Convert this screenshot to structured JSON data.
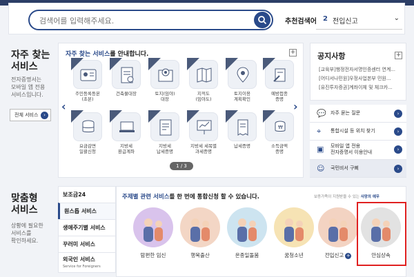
{
  "search": {
    "placeholder": "검색어를 입력해주세요.",
    "recommend_label": "추천검색어",
    "recommend_num": "2",
    "recommend_value": "전입신고"
  },
  "frequent": {
    "section_title": "자주 찾는\n서비스",
    "section_desc": "전자증명서는\n모바일 앱 전용\n서비스입니다.",
    "all_button": "전체 서비스",
    "panel_title_highlight": "자주 찾는 서비스",
    "panel_title_rest": "를 안내합니다.",
    "pager": "1 / 3",
    "items": [
      {
        "label": "주민등록등본\n(초본)",
        "icon": "id-card-icon"
      },
      {
        "label": "건축물대장",
        "icon": "document-icon"
      },
      {
        "label": "토지(임야)\n대장",
        "icon": "land-map-icon"
      },
      {
        "label": "지적도\n(임야도)",
        "icon": "map-icon"
      },
      {
        "label": "토지이용\n계획확인",
        "icon": "location-icon"
      },
      {
        "label": "예방접종\n증명",
        "icon": "vaccine-icon"
      },
      {
        "label": "요금감면\n일괄신청",
        "icon": "coins-icon"
      },
      {
        "label": "지방세\n환급계좌",
        "icon": "laptop-icon"
      },
      {
        "label": "지방세\n납세증명",
        "icon": "tax-document-icon"
      },
      {
        "label": "지방세 세목별\n과세증명",
        "icon": "presentation-icon"
      },
      {
        "label": "납세증명",
        "icon": "receipt-icon"
      },
      {
        "label": "소득금액\n증명",
        "icon": "coin-stack-icon"
      }
    ]
  },
  "notice": {
    "title": "공지사항",
    "items": [
      "[교육부]행정전자서명인증센터 연계...",
      "[어디서나민원]우정사업본부 민원...",
      "[유진투자증권]계좌이체 및 체크카..."
    ]
  },
  "quick": [
    {
      "label": "자주 묻는 질문",
      "icon": "chat-icon"
    },
    {
      "label": "통합시설 등 위치 찾기",
      "icon": "location-pin-icon"
    },
    {
      "label": "모바일 앱 전용\n전자증명서 이용안내",
      "icon": "mobile-app-icon"
    },
    {
      "label": "국민비서 구삐",
      "icon": "assistant-icon"
    }
  ],
  "custom": {
    "section_title": "맞춤형\n서비스",
    "section_desc": "상황에 필요한\n서비스를\n확인하세요.",
    "tabs": [
      {
        "label": "보조금24"
      },
      {
        "label": "원스톱 서비스"
      },
      {
        "label": "생애주기별 서비스"
      },
      {
        "label": "꾸러미 서비스"
      },
      {
        "label": "외국인 서비스",
        "sub": "Service for Foreigners"
      }
    ],
    "title_highlight": "주제별 관련 서비스",
    "title_rest": "를 한 번에 통합신청 할 수 있습니다.",
    "note_rest": "보증가족이 지원받을 수 있는 ",
    "note_highlight": "사망의 예우",
    "events": [
      {
        "label": "맘편한 임신",
        "color": "#d9c3ec"
      },
      {
        "label": "행복출산",
        "color": "#f3d6c5"
      },
      {
        "label": "온종일돌봄",
        "color": "#cde4f0"
      },
      {
        "label": "꿈청소년",
        "color": "#f6e3b4"
      },
      {
        "label": "전입신고",
        "color": "#f3d3c2"
      },
      {
        "label": "안심상속",
        "color": "#e2e2e2"
      }
    ]
  },
  "colors": {
    "primary": "#2a4a8a",
    "highlight_border": "#e02020"
  }
}
